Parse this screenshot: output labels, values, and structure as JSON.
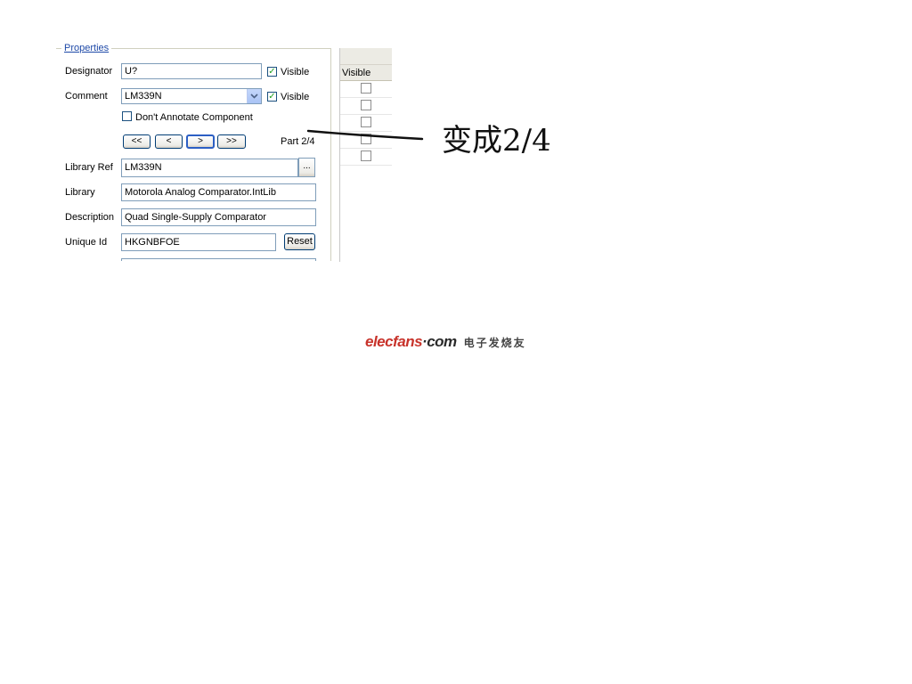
{
  "properties": {
    "group_title": "Properties",
    "designator": {
      "label": "Designator",
      "value": "U?",
      "visible_label": "Visible",
      "visible_checked": true
    },
    "comment": {
      "label": "Comment",
      "value": "LM339N",
      "visible_label": "Visible",
      "visible_checked": true
    },
    "dont_annotate": {
      "label": "Don't Annotate Component",
      "checked": false
    },
    "part_nav": {
      "first_label": "<<",
      "prev_label": "<",
      "next_label": ">",
      "last_label": ">>",
      "part_label": "Part 2/4"
    },
    "library_ref": {
      "label": "Library Ref",
      "value": "LM339N",
      "browse_label": "..."
    },
    "library": {
      "label": "Library",
      "value": "Motorola Analog Comparator.IntLib"
    },
    "description": {
      "label": "Description",
      "value": "Quad Single-Supply Comparator"
    },
    "unique_id": {
      "label": "Unique Id",
      "value": "HKGNBFOE",
      "reset_label": "Reset"
    }
  },
  "grid": {
    "column_header": "Visible",
    "rows": [
      {
        "checked": false
      },
      {
        "checked": false
      },
      {
        "checked": false
      },
      {
        "checked": false
      },
      {
        "checked": false
      }
    ]
  },
  "annotation": {
    "text": "变成2/4"
  },
  "watermark": {
    "logo_part1": "elecfans",
    "logo_part2": "·com",
    "tagline": "电子发烧友"
  },
  "colors": {
    "accent_title": "#1f4aa8",
    "check_mark": "#21a121",
    "field_border": "#7f9db9"
  }
}
